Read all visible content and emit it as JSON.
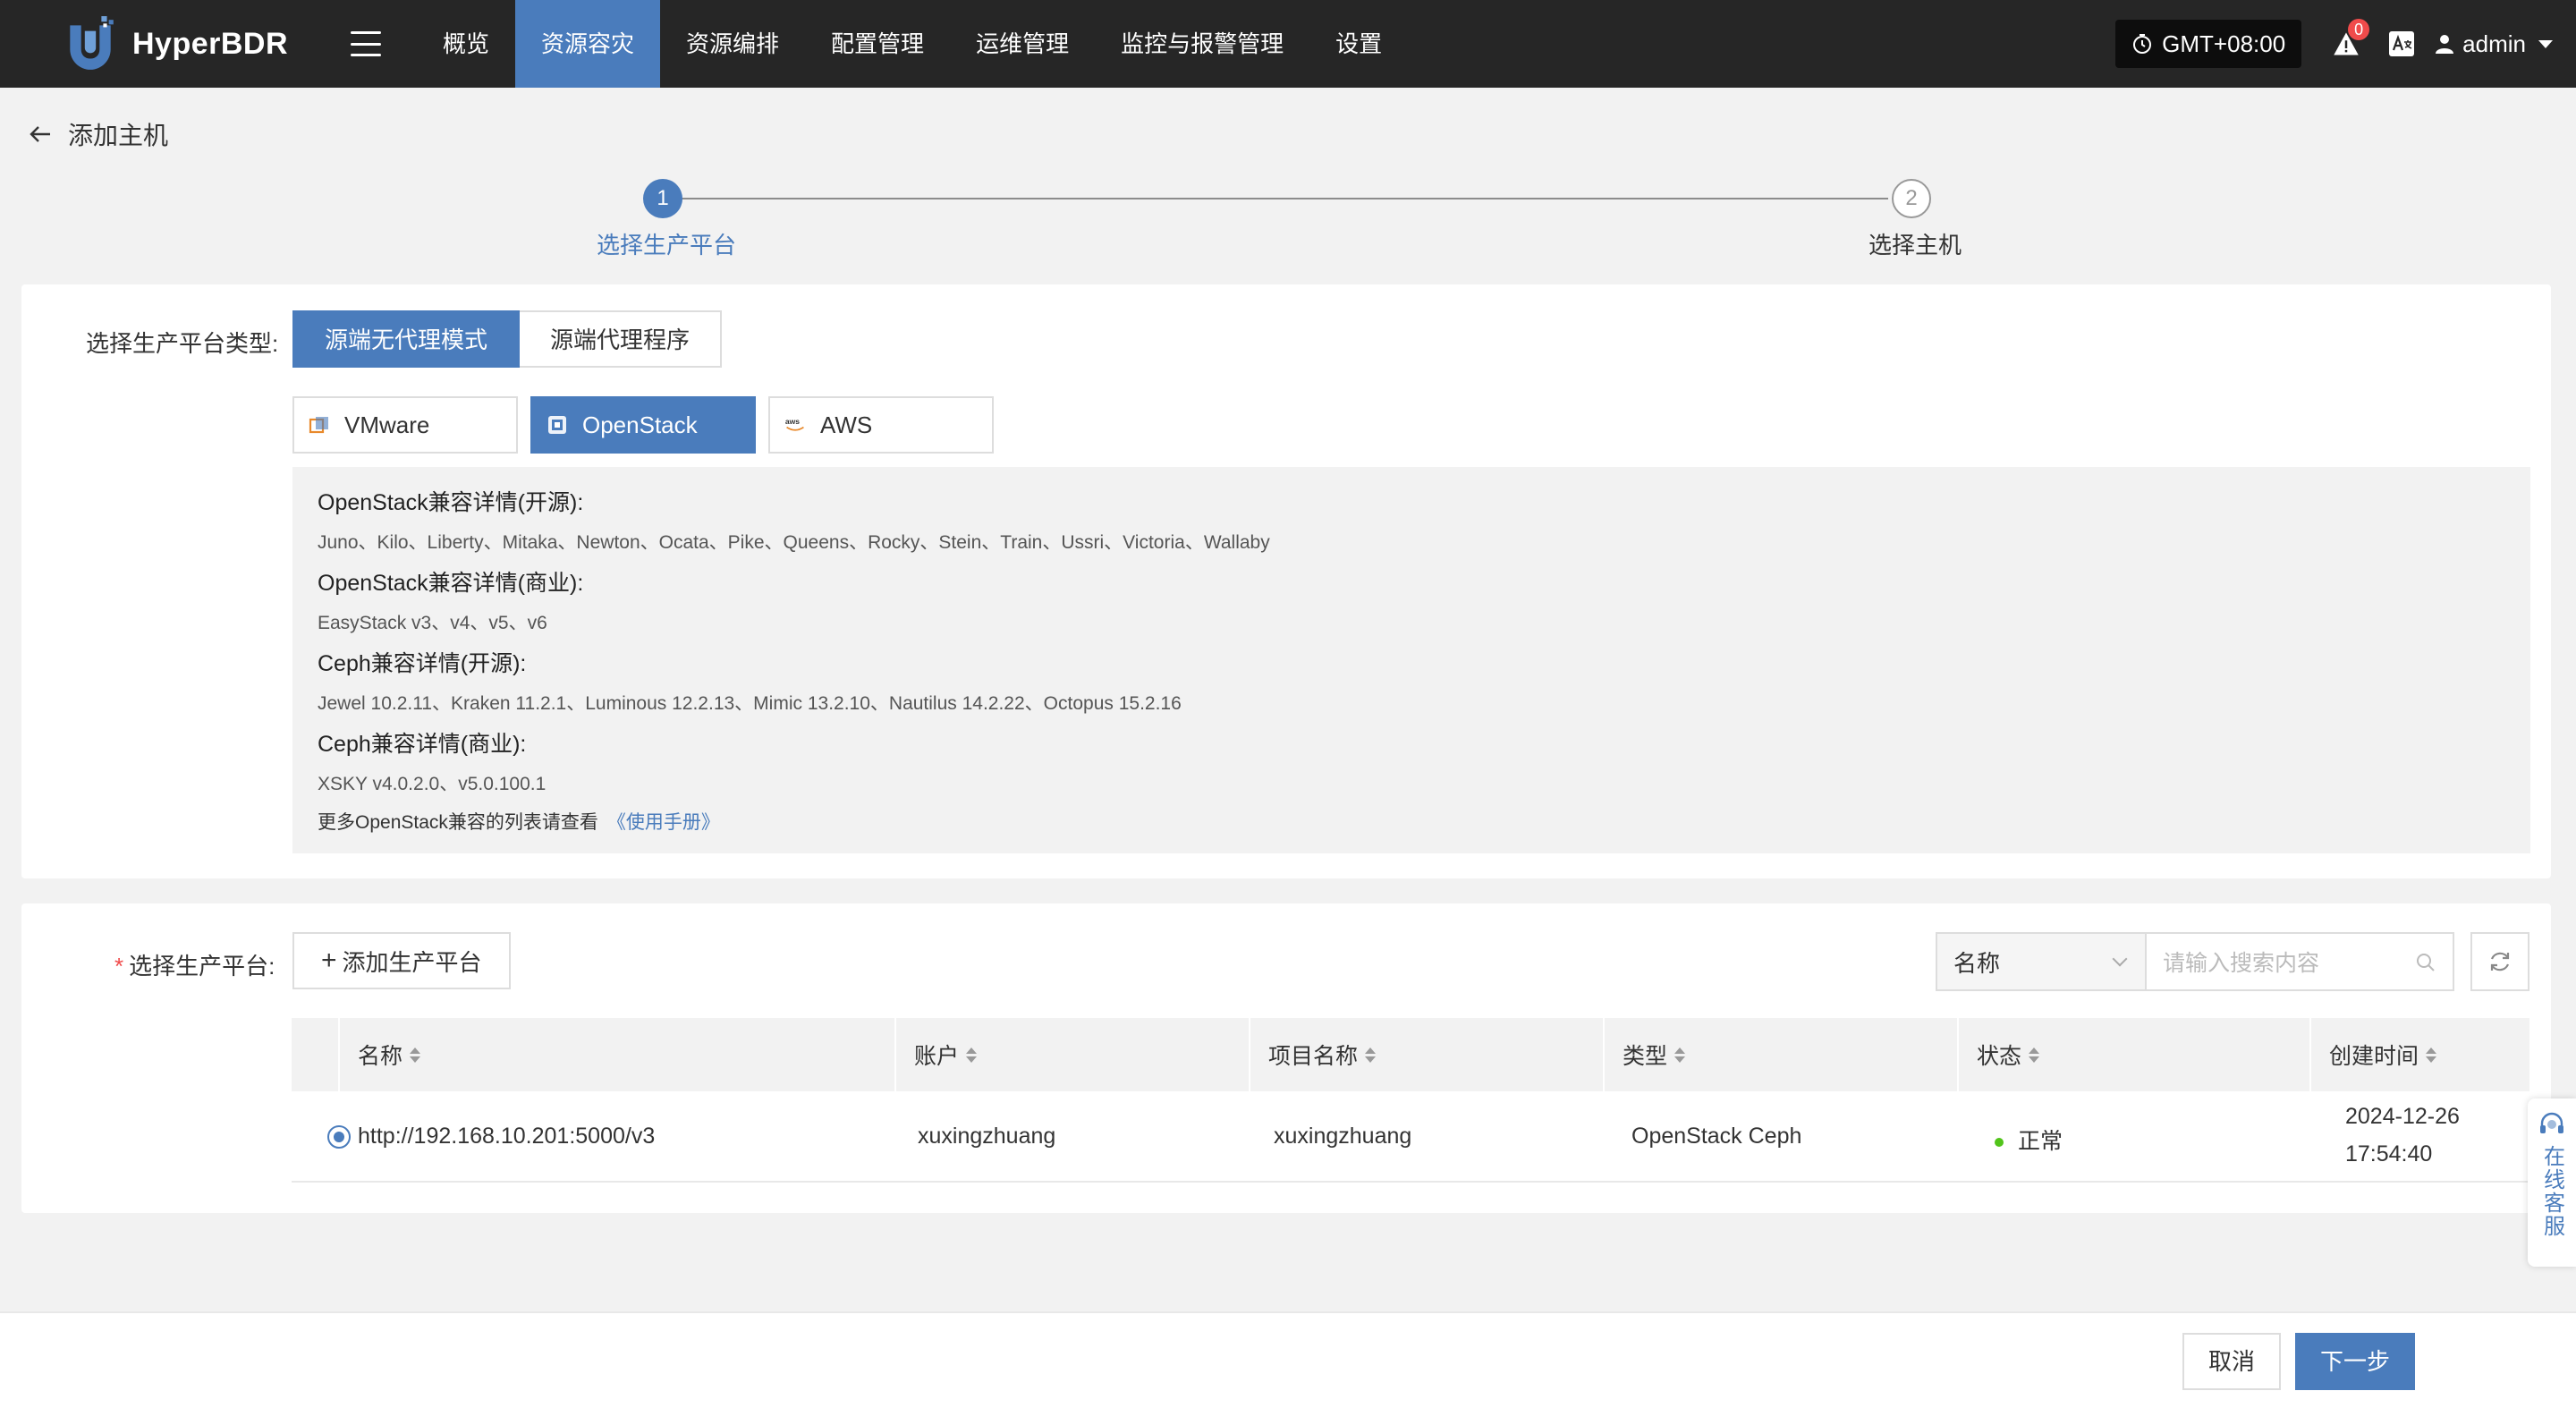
{
  "brand": {
    "name": "HyperBDR",
    "logo_icon": "shield-logo-icon"
  },
  "nav": {
    "items": [
      {
        "label": "概览",
        "active": false
      },
      {
        "label": "资源容灾",
        "active": true
      },
      {
        "label": "资源编排",
        "active": false
      },
      {
        "label": "配置管理",
        "active": false
      },
      {
        "label": "运维管理",
        "active": false
      },
      {
        "label": "监控与报警管理",
        "active": false
      },
      {
        "label": "设置",
        "active": false
      }
    ]
  },
  "header": {
    "timezone": "GMT+08:00",
    "alert_count": "0",
    "user": "admin"
  },
  "page": {
    "title": "添加主机"
  },
  "steps": [
    {
      "number": "1",
      "label": "选择生产平台",
      "active": true
    },
    {
      "number": "2",
      "label": "选择主机",
      "active": false
    }
  ],
  "platform_type": {
    "label": "选择生产平台类型:",
    "modes": [
      {
        "label": "源端无代理模式",
        "active": true
      },
      {
        "label": "源端代理程序",
        "active": false
      }
    ],
    "platforms": [
      {
        "label": "VMware",
        "icon": "vmware-icon",
        "active": false
      },
      {
        "label": "OpenStack",
        "icon": "openstack-icon",
        "active": true
      },
      {
        "label": "AWS",
        "icon": "aws-icon",
        "active": false
      }
    ]
  },
  "compat": {
    "sections": [
      {
        "title": "OpenStack兼容详情(开源):",
        "body": "Juno、Kilo、Liberty、Mitaka、Newton、Ocata、Pike、Queens、Rocky、Stein、Train、Ussri、Victoria、Wallaby"
      },
      {
        "title": "OpenStack兼容详情(商业):",
        "body": "EasyStack v3、v4、v5、v6"
      },
      {
        "title": "Ceph兼容详情(开源):",
        "body": "Jewel 10.2.11、Kraken 11.2.1、Luminous 12.2.13、Mimic 13.2.10、Nautilus 14.2.22、Octopus 15.2.16"
      },
      {
        "title": "Ceph兼容详情(商业):",
        "body": "XSKY v4.0.2.0、v5.0.100.1"
      }
    ],
    "footer_text": "更多OpenStack兼容的列表请查看",
    "footer_link": "《使用手册》"
  },
  "platform_select": {
    "required_mark": "*",
    "label": "选择生产平台:",
    "add_button": "添加生产平台",
    "search_field": "名称",
    "search_placeholder": "请输入搜索内容"
  },
  "table": {
    "columns": [
      "名称",
      "账户",
      "项目名称",
      "类型",
      "状态",
      "创建时间"
    ],
    "rows": [
      {
        "selected": true,
        "name": "http://192.168.10.201:5000/v3",
        "account": "xuxingzhuang",
        "project": "xuxingzhuang",
        "type": "OpenStack Ceph",
        "status": "正常",
        "created_date": "2024-12-26",
        "created_time": "17:54:40"
      }
    ]
  },
  "service": {
    "label": "在线客服"
  },
  "footer": {
    "cancel": "取消",
    "next": "下一步"
  },
  "colors": {
    "primary": "#4a7cbc",
    "topbar": "#262626",
    "success": "#52c41a",
    "danger": "#f04b4b"
  }
}
